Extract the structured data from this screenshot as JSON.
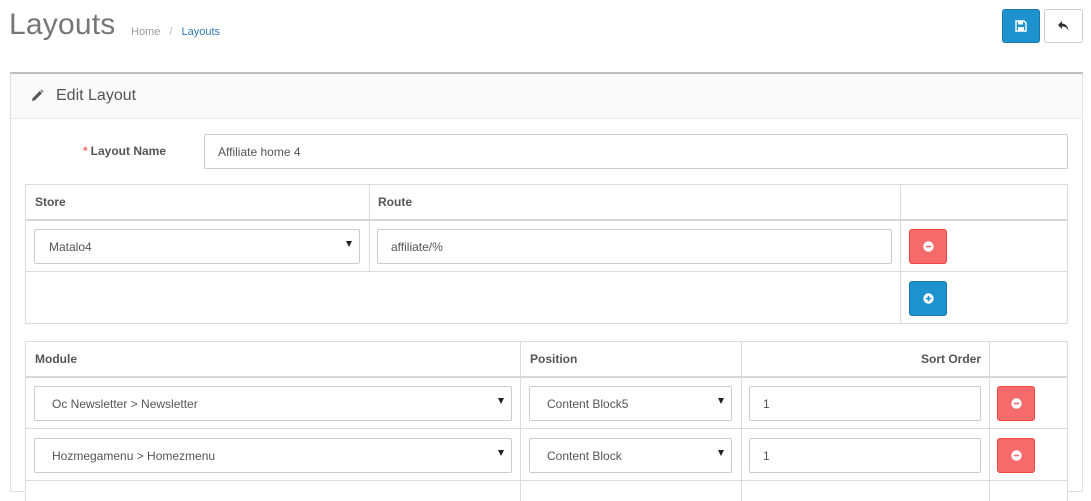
{
  "header": {
    "title": "Layouts",
    "breadcrumb": [
      {
        "label": "Home"
      },
      {
        "label": "Layouts"
      }
    ],
    "save_icon": "floppy-disk-icon",
    "back_icon": "reply-arrow-icon"
  },
  "panel": {
    "heading": "Edit Layout",
    "heading_icon": "pencil-icon"
  },
  "form": {
    "layout_name_required": "*",
    "layout_name_label": "Layout Name",
    "layout_name_value": "Affiliate home 4"
  },
  "routes_table": {
    "headers": {
      "store": "Store",
      "route": "Route"
    },
    "rows": [
      {
        "store": "Matalo4",
        "route": "affiliate/%"
      }
    ]
  },
  "modules_table": {
    "headers": {
      "module": "Module",
      "position": "Position",
      "sort_order": "Sort Order"
    },
    "rows": [
      {
        "module": "Oc Newsletter > Newsletter",
        "position": "Content Block5",
        "sort_order": "1"
      },
      {
        "module": "Hozmegamenu > Homezmenu",
        "position": "Content Block",
        "sort_order": "1"
      }
    ]
  },
  "colors": {
    "primary": "#1e91cf",
    "danger": "#f56b6b",
    "link": "#337ab7"
  }
}
